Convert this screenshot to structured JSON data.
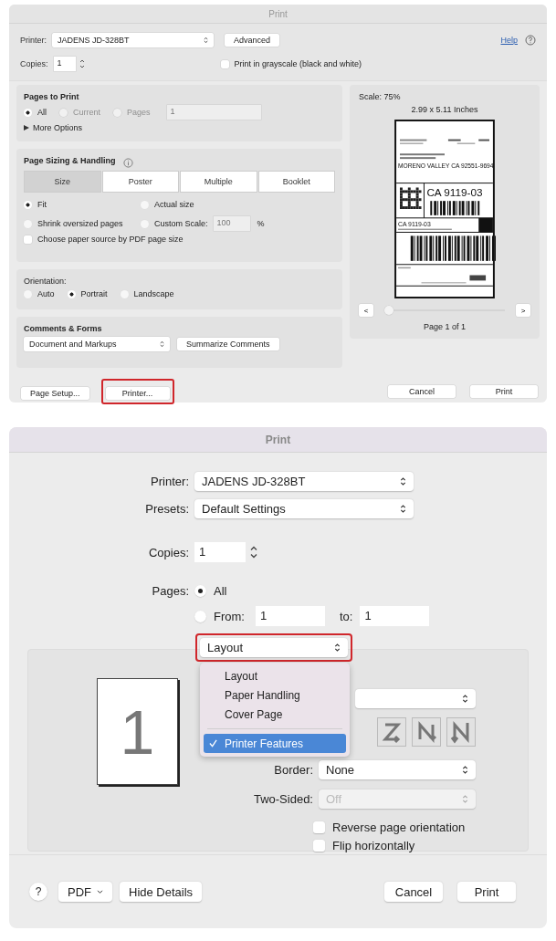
{
  "dialog_1": {
    "title": "Print",
    "printer": {
      "label": "Printer:",
      "value": "JADENS JD-328BT"
    },
    "advanced_button": "Advanced",
    "help_link": "Help",
    "copies": {
      "label": "Copies:",
      "value": "1"
    },
    "grayscale": {
      "label": "Print in grayscale (black and white)",
      "checked": false
    },
    "pages_to_print": {
      "title": "Pages to Print",
      "options": [
        {
          "label": "All",
          "selected": true,
          "disabled": false
        },
        {
          "label": "Current",
          "selected": false,
          "disabled": true
        },
        {
          "label": "Pages",
          "selected": false,
          "disabled": true
        }
      ],
      "pages_field": "1",
      "more_options": "More Options"
    },
    "page_sizing": {
      "title": "Page Sizing & Handling",
      "tabs": [
        {
          "label": "Size",
          "selected": true
        },
        {
          "label": "Poster",
          "selected": false
        },
        {
          "label": "Multiple",
          "selected": false
        },
        {
          "label": "Booklet",
          "selected": false
        }
      ],
      "options": [
        {
          "label": "Fit",
          "selected": true
        },
        {
          "label": "Actual size",
          "selected": false
        },
        {
          "label": "Shrink oversized pages",
          "selected": false
        },
        {
          "label": "Custom Scale:",
          "selected": false
        }
      ],
      "scale_field": "100",
      "scale_unit": "%",
      "paper_source": {
        "label": "Choose paper source by PDF page size",
        "checked": false
      }
    },
    "orientation": {
      "title": "Orientation:",
      "options": [
        {
          "label": "Auto",
          "selected": false
        },
        {
          "label": "Portrait",
          "selected": true
        },
        {
          "label": "Landscape",
          "selected": false
        }
      ]
    },
    "comments_forms": {
      "title": "Comments & Forms",
      "select": "Document and Markups",
      "button": "Summarize Comments"
    },
    "preview": {
      "scale": "Scale:  75%",
      "size": "2.99 x 5.11 Inches",
      "label_texts": [
        "MORENO VALLEY CA 92551-9694",
        "CA 9119-03",
        "CA 9119-03"
      ],
      "prev": "<",
      "next": ">",
      "page_slider": {
        "level": 0
      },
      "page_label": "Page 1 of 1"
    },
    "buttons_left": [
      {
        "label": "Page Setup...",
        "highlighted": false
      },
      {
        "label": "Printer...",
        "highlighted": true
      }
    ],
    "buttons_right": [
      "Cancel",
      "Print"
    ]
  },
  "dialog_2": {
    "title": "Print",
    "printer": {
      "label": "Printer:",
      "value": "JADENS JD-328BT"
    },
    "presets": {
      "label": "Presets:",
      "value": "Default Settings"
    },
    "copies": {
      "label": "Copies:",
      "value": "1"
    },
    "pages": {
      "label": "Pages:",
      "options": [
        {
          "label": "All",
          "selected": true
        },
        {
          "label": "From:",
          "selected": false
        }
      ],
      "from": "1",
      "to_label": "to:",
      "to": "1"
    },
    "section_select": {
      "value": "Layout",
      "highlighted": true
    },
    "menu": {
      "items": [
        {
          "label": "Layout",
          "selected": false
        },
        {
          "label": "Paper Handling",
          "selected": false
        },
        {
          "label": "Cover Page",
          "selected": false
        },
        {
          "label": "Printer Features",
          "selected": true
        }
      ]
    },
    "page_thumbnail": "1",
    "border": {
      "label": "Border:",
      "value": "None"
    },
    "two_sided": {
      "label": "Two-Sided:",
      "value": "Off",
      "disabled": true
    },
    "checkboxes": [
      {
        "label": "Reverse page orientation",
        "checked": false
      },
      {
        "label": "Flip horizontally",
        "checked": false
      }
    ],
    "footer": {
      "help": "?",
      "pdf": "PDF",
      "hide_details": "Hide Details",
      "cancel": "Cancel",
      "print": "Print"
    }
  }
}
